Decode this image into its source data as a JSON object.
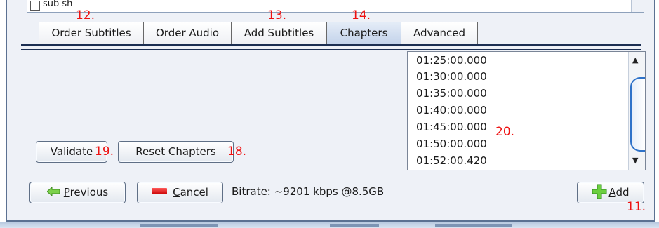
{
  "top_list": {
    "item_text": "sub sh"
  },
  "tabs": [
    {
      "label": "Order Subtitles",
      "active": false
    },
    {
      "label": "Order Audio",
      "active": false
    },
    {
      "label": "Add Subtitles",
      "active": false
    },
    {
      "label": "Chapters",
      "active": true
    },
    {
      "label": "Advanced",
      "active": false
    }
  ],
  "chapters": [
    "01:25:00.000",
    "01:30:00.000",
    "01:35:00.000",
    "01:40:00.000",
    "01:45:00.000",
    "01:50:00.000",
    "01:52:00.420"
  ],
  "buttons": {
    "validate_underline": "V",
    "validate_rest": "alidate",
    "reset_chapters": "Reset Chapters",
    "previous_underline": "P",
    "previous_rest": "revious",
    "cancel_underline": "C",
    "cancel_rest": "ancel",
    "add_underline": "A",
    "add_rest": "dd"
  },
  "status": {
    "bitrate": "Bitrate:  ~9201  kbps  @8.5GB"
  },
  "annotations": {
    "a11": "11.",
    "a12": "12.",
    "a13": "13.",
    "a14": "14.",
    "a18": "18.",
    "a19": "19.",
    "a20": "20."
  },
  "colors": {
    "annotation": "#ee1111",
    "tab_active": "#c2d2ea",
    "scroll_thumb_border": "#2e72c9"
  }
}
